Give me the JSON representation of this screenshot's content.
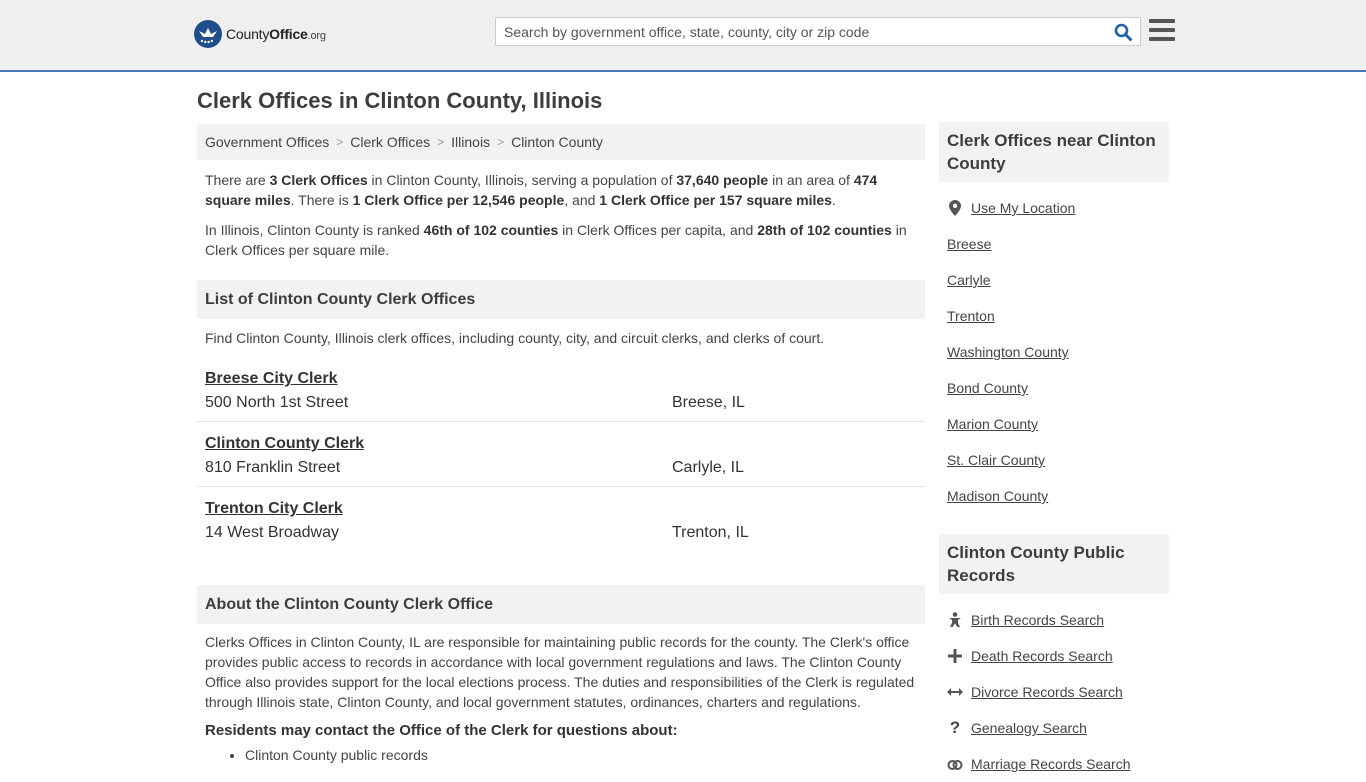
{
  "header": {
    "logo_brand": "County",
    "logo_brand_bold": "Office",
    "logo_tld": ".org",
    "search_placeholder": "Search by government office, state, county, city or zip code"
  },
  "page_title": "Clerk Offices in Clinton County, Illinois",
  "breadcrumb": [
    "Government Offices",
    "Clerk Offices",
    "Illinois",
    "Clinton County"
  ],
  "intro": {
    "p1": {
      "t1": "There are ",
      "b1": "3 Clerk Offices",
      "t2": " in Clinton County, Illinois, serving a population of ",
      "b2": "37,640 people",
      "t3": " in an area of ",
      "b3": "474 square miles",
      "t4": ". There is ",
      "b4": "1 Clerk Office per 12,546 people",
      "t5": ", and ",
      "b5": "1 Clerk Office per 157 square miles",
      "t6": "."
    },
    "p2": {
      "t1": "In Illinois, Clinton County is ranked ",
      "b1": "46th of 102 counties",
      "t2": " in Clerk Offices per capita, and ",
      "b2": "28th of 102 counties",
      "t3": " in Clerk Offices per square mile."
    }
  },
  "list_section": {
    "heading": "List of Clinton County Clerk Offices",
    "description": "Find Clinton County, Illinois clerk offices, including county, city, and circuit clerks, and clerks of court.",
    "offices": [
      {
        "name": "Breese City Clerk",
        "address": "500 North 1st Street",
        "city": "Breese, IL"
      },
      {
        "name": "Clinton County Clerk",
        "address": "810 Franklin Street",
        "city": "Carlyle, IL"
      },
      {
        "name": "Trenton City Clerk",
        "address": "14 West Broadway",
        "city": "Trenton, IL"
      }
    ]
  },
  "about_section": {
    "heading": "About the Clinton County Clerk Office",
    "paragraph": "Clerks Offices in Clinton County, IL are responsible for maintaining public records for the county. The Clerk's office provides public access to records in accordance with local government regulations and laws. The Clinton County Office also provides support for the local elections process. The duties and responsibilities of the Clerk is regulated through Illinois state, Clinton County, and local government statutes, ordinances, charters and regulations.",
    "subheading": "Residents may contact the Office of the Clerk for questions about:",
    "bullets": [
      "Clinton County public records"
    ]
  },
  "sidebar": {
    "nearby_heading": "Clerk Offices near Clinton County",
    "use_location": "Use My Location",
    "nearby": [
      "Breese",
      "Carlyle",
      "Trenton",
      "Washington County",
      "Bond County",
      "Marion County",
      "St. Clair County",
      "Madison County"
    ],
    "records_heading": "Clinton County Public Records",
    "records": [
      {
        "label": "Birth Records Search",
        "icon": "baby-icon"
      },
      {
        "label": "Death Records Search",
        "icon": "cross-icon"
      },
      {
        "label": "Divorce Records Search",
        "icon": "split-arrows-icon"
      },
      {
        "label": "Genealogy Search",
        "icon": "question-icon"
      },
      {
        "label": "Marriage Records Search",
        "icon": "rings-icon"
      }
    ]
  },
  "colors": {
    "accent": "#4a79b6",
    "logo": "#1f4e8a",
    "search_icon": "#1f5fa8"
  }
}
